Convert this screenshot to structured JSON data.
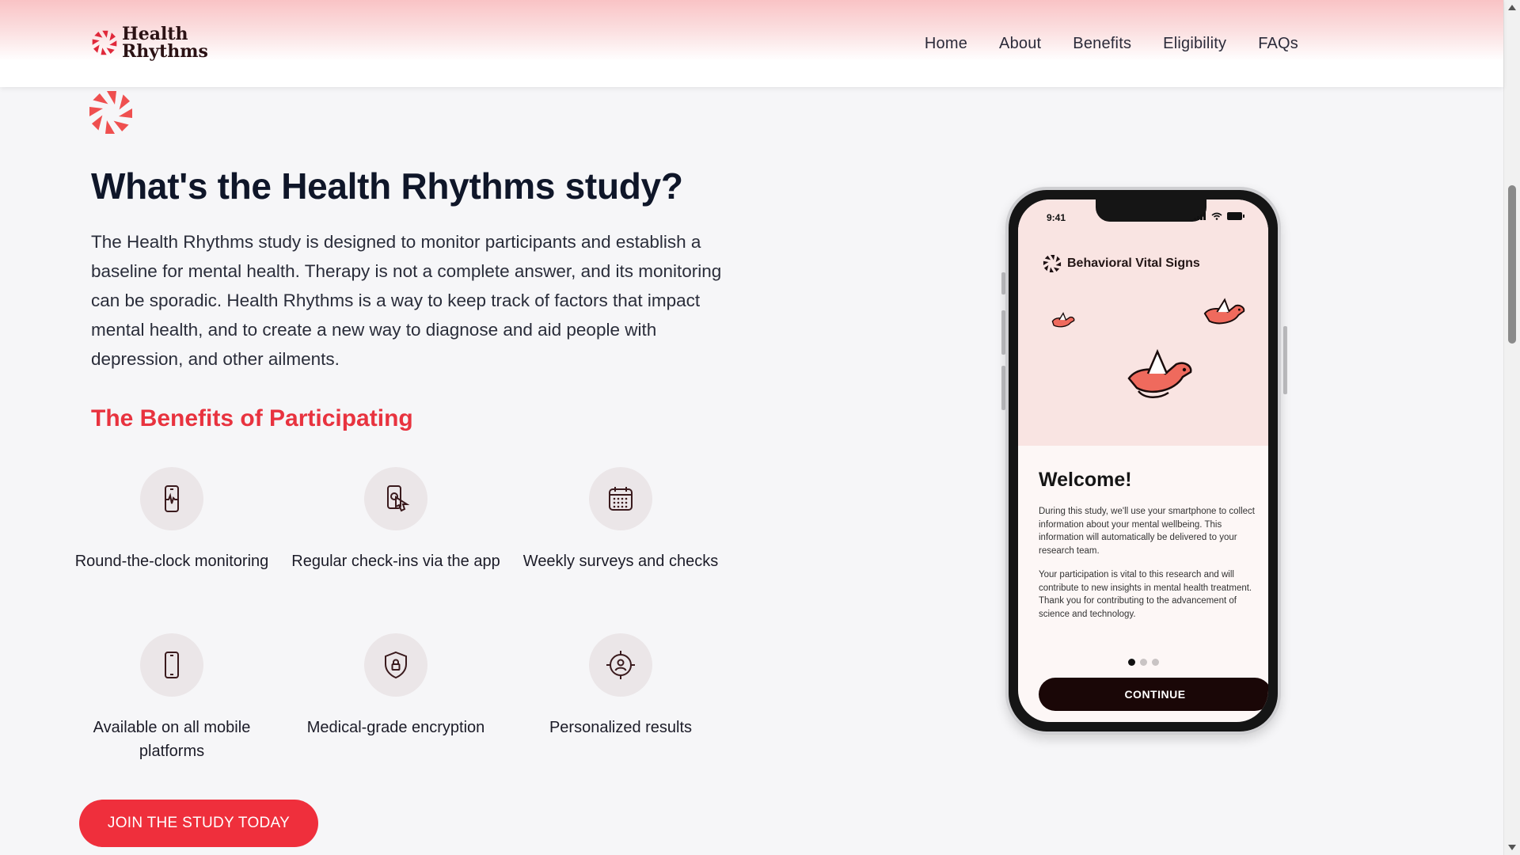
{
  "brand": {
    "line1": "Health",
    "line2": "Rhythms",
    "color": "#e8333f"
  },
  "nav": {
    "items": [
      "Home",
      "About",
      "Benefits",
      "Eligibility",
      "FAQs"
    ]
  },
  "hero": {
    "title": "What's the Health Rhythms study?",
    "description": "The Health Rhythms study is designed to monitor participants and establish a baseline for mental health. Therapy is not a complete answer, and its monitoring can be sporadic. Health Rhythms is a way to keep track of factors that impact mental health, and to create a new way to diagnose and aid people with depression, and other ailments."
  },
  "benefits": {
    "title": "The Benefits of Participating",
    "items": [
      {
        "label": "Round-the-clock monitoring",
        "icon": "phone-heartbeat-icon"
      },
      {
        "label": "Regular check-ins via the app",
        "icon": "phone-tap-icon"
      },
      {
        "label": "Weekly surveys and checks",
        "icon": "calendar-icon"
      },
      {
        "label": "Available on all mobile platforms",
        "icon": "mobile-phone-icon"
      },
      {
        "label": "Medical-grade encryption",
        "icon": "shield-lock-icon"
      },
      {
        "label": "Personalized results",
        "icon": "target-person-icon"
      }
    ]
  },
  "cta": {
    "label": "JOIN THE STUDY TODAY",
    "color": "#ef2f3c"
  },
  "phone": {
    "time": "9:41",
    "app_title": "Behavioral Vital Signs",
    "welcome": "Welcome!",
    "paragraph1": "During this study, we'll use your smartphone to collect information about your mental wellbeing. This information will automatically be delivered to your research team.",
    "paragraph2": "Your participation is vital to this research and will contribute to new insights in mental health treatment. Thank you for contributing to the advancement of science and technology.",
    "continue_label": "CONTINUE",
    "pager": {
      "current": 1,
      "total": 3
    }
  }
}
